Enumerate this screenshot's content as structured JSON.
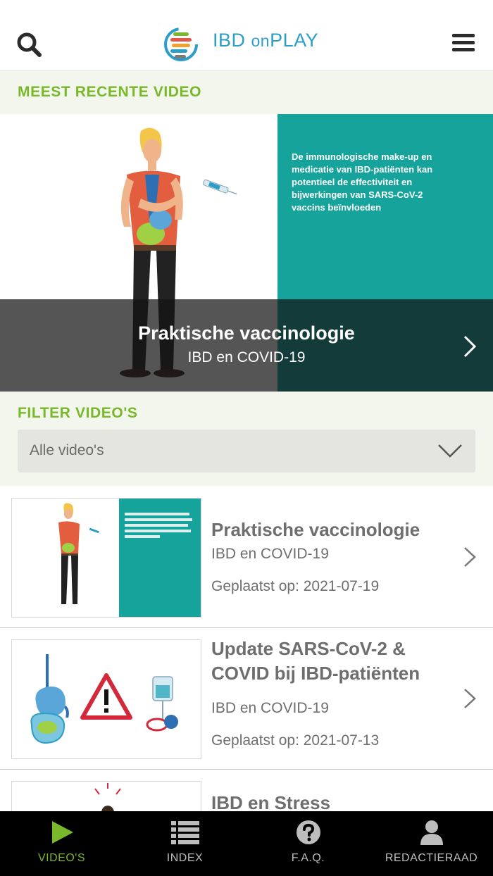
{
  "header": {
    "logo_text_pre": "IBD ",
    "logo_text_on": "on",
    "logo_text_post": "PLAY"
  },
  "recent": {
    "heading": "MEEST RECENTE VIDEO",
    "title": "Praktische vaccinologie",
    "category": "IBD en COVID-19",
    "quote": "De immunologische make-up en medicatie van IBD-patiënten kan potentieel de effectiviteit en bijwerkingen van SARS-CoV-2 vaccins beïnvloeden"
  },
  "filter": {
    "heading": "FILTER VIDEO'S",
    "selected": "Alle video's"
  },
  "videos": [
    {
      "title": "Praktische vaccinologie",
      "category": "IBD en COVID-19",
      "date": "Geplaatst op: 2021-07-19"
    },
    {
      "title": "Update SARS-CoV-2 & COVID bij IBD-patiënten",
      "category": "IBD en COVID-19",
      "date": "Geplaatst op: 2021-07-13"
    },
    {
      "title": "IBD en Stress",
      "category": "",
      "date": ""
    }
  ],
  "tabs": [
    {
      "label": "VIDEO'S",
      "icon": "play-icon"
    },
    {
      "label": "INDEX",
      "icon": "list-icon"
    },
    {
      "label": "F.A.Q.",
      "icon": "question-icon"
    },
    {
      "label": "REDACTIERAAD",
      "icon": "person-icon"
    }
  ],
  "colors": {
    "accent_green": "#78b82a",
    "brand_blue": "#2d9fc7",
    "teal": "#15a39b",
    "tabbar_bg": "#000000"
  }
}
